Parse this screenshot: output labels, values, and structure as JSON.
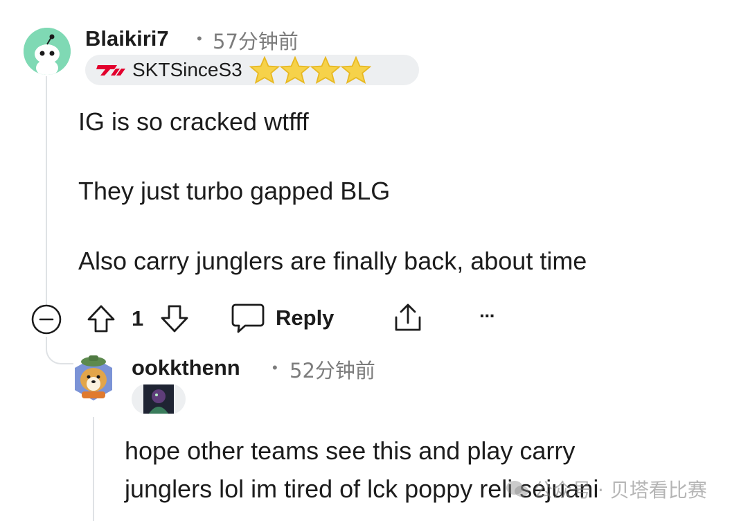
{
  "comment1": {
    "username": "Blaikiri7",
    "time": "57分钟前",
    "flair_text": "SKTSinceS3",
    "flair_stars": 4,
    "lines": [
      "IG is so cracked wtfff",
      "They just turbo gapped BLG",
      "Also carry junglers are finally back, about time"
    ],
    "vote_count": "1",
    "reply_label": "Reply",
    "more_label": "···"
  },
  "comment2": {
    "username": "ookkthenn",
    "time": "52分钟前",
    "lines": [
      "hope other teams see this and play carry",
      "junglers lol im tired of lck poppy reli sejuani"
    ]
  },
  "watermark": "公众号 · 贝塔看比赛",
  "colors": {
    "avatar1_bg": "#7fd9b4",
    "flair_bg": "#edeff1",
    "star": "#f3c623",
    "skt_red": "#e2012d",
    "thread": "#dfe2e5"
  },
  "icons": [
    "snoo-avatar-icon",
    "skt-logo-icon",
    "star-icon",
    "collapse-icon",
    "upvote-icon",
    "downvote-icon",
    "comment-bubble-icon",
    "share-icon",
    "corgi-avatar-icon",
    "champion-flair-icon"
  ]
}
